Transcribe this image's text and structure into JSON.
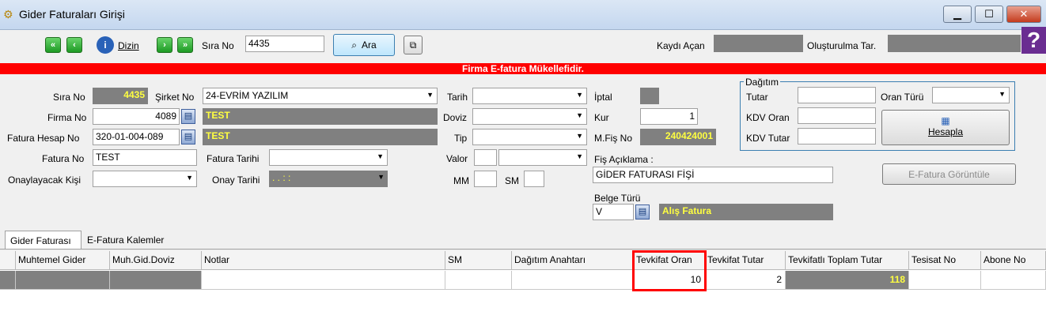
{
  "window": {
    "title": "Gider Faturaları Girişi",
    "minimize": "▁",
    "maximize": "☐",
    "close": "✕"
  },
  "toolbar": {
    "dizin_label": "Dizin",
    "sira_no_label": "Sıra No",
    "sira_no_value": "4435",
    "ara_label": "Ara",
    "kaydi_acan_label": "Kaydı Açan",
    "olusturulma_label": "Oluşturulma Tar.",
    "help": "?"
  },
  "banner": "Firma E-fatura Mükellefidir.",
  "form": {
    "sira_no_label": "Sıra No",
    "sira_no_value": "4435",
    "sirket_no_label": "Şirket No",
    "sirket_no_value": "24-EVRİM YAZILIM",
    "firma_no_label": "Firma No",
    "firma_no_value": "4089",
    "firma_name": "TEST",
    "fatura_hesap_no_label": "Fatura Hesap No",
    "fatura_hesap_no_value": "320-01-004-089",
    "hesap_name": "TEST",
    "fatura_no_label": "Fatura No",
    "fatura_no_value": "TEST",
    "fatura_tarihi_label": "Fatura Tarihi",
    "onaylayacak_kisi_label": "Onaylayacak Kişi",
    "onay_tarihi_label": "Onay Tarihi",
    "onay_tarihi_value": ". .     : :",
    "tarih_label": "Tarih",
    "doviz_label": "Doviz",
    "tip_label": "Tip",
    "valor_label": "Valor",
    "mm_label": "MM",
    "sm_label": "SM",
    "iptal_label": "İptal",
    "kur_label": "Kur",
    "kur_value": "1",
    "mfis_no_label": "M.Fiş No",
    "mfis_no_value": "240424001",
    "fis_aciklama_label": "Fiş Açıklama :",
    "fis_aciklama_value": "GİDER FATURASI FİŞİ",
    "belge_turu_label": "Belge Türü",
    "belge_turu_value": "V",
    "belge_turu_name": "Alış Fatura",
    "efatura_button": "E-Fatura Görüntüle"
  },
  "dagitim": {
    "legend": "Dağıtım",
    "tutar_label": "Tutar",
    "oran_turu_label": "Oran Türü",
    "kdv_oran_label": "KDV Oran",
    "kdv_tutar_label": "KDV Tutar",
    "hesapla_label": "Hesapla"
  },
  "tabs": [
    "Gider Faturası",
    "E-Fatura Kalemler"
  ],
  "grid": {
    "columns": [
      "Muhtemel Gider",
      "Muh.Gid.Doviz",
      "Notlar",
      "SM",
      "Dağıtım Anahtarı",
      "Tevkifat Oran",
      "Tevkifat Tutar",
      "Tevkifatlı Toplam Tutar",
      "Tesisat No",
      "Abone No"
    ],
    "row": [
      "",
      "",
      "",
      "",
      "",
      "10",
      "2",
      "118",
      "",
      ""
    ]
  },
  "colors": {
    "highlight": "#ff0000",
    "gray_field": "#808080",
    "yellow_text": "#ffff40"
  }
}
